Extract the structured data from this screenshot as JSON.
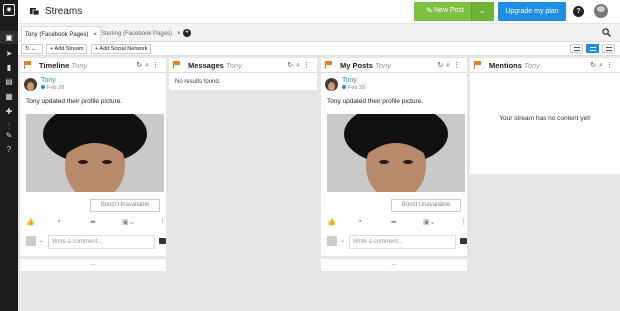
{
  "app": {
    "title": "Streams"
  },
  "header": {
    "new_post_label": "New Post",
    "upgrade_label": "Upgrade my plan",
    "help_label": "?"
  },
  "tabs": [
    {
      "label": "Tony (Facebook Pages)",
      "close": "×"
    },
    {
      "label": "Sterling (Facebook Pages)",
      "close": "×"
    }
  ],
  "toolbar": {
    "add_stream_label": "+ Add Stream",
    "add_network_label": "+ Add Social Network"
  },
  "columns": [
    {
      "title": "Timeline",
      "subtitle": "Tony"
    },
    {
      "title": "Messages",
      "subtitle": "Tony",
      "empty_text": "No results found."
    },
    {
      "title": "My Posts",
      "subtitle": "Tony"
    },
    {
      "title": "Mentions",
      "subtitle": "Tony",
      "empty_text": "Your stream has no content yet!"
    }
  ],
  "post": {
    "author": "Tony",
    "date": "Feb 28",
    "text": "Tony updated their profile picture.",
    "boost_label": "Boost Unavailable",
    "comment_placeholder": "Write a comment...",
    "more_label": "..."
  },
  "colors": {
    "accent_green": "#7cc142",
    "accent_blue": "#1f8fe6",
    "flag_orange": "#e67e22",
    "rail": "#1c1c1c"
  },
  "icons": [
    "streams-icon",
    "compose-icon",
    "analytics-icon",
    "assignments-icon",
    "publisher-icon",
    "apps-icon",
    "insights-icon",
    "tools-icon",
    "help-icon"
  ]
}
